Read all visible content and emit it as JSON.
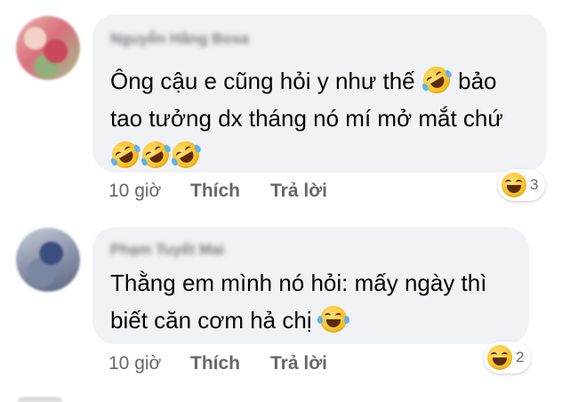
{
  "comments": [
    {
      "author": "Nguyễn Hằng Bosa",
      "text_lines": [
        "Ông cậu e cũng hỏi y như thế",
        "bảo",
        "tao tưởng dx tháng nó mí mở mắt chứ"
      ],
      "time": "10 giờ",
      "like_label": "Thích",
      "reply_label": "Trả lời",
      "reaction_icon": "laughing-face-icon",
      "reaction_count": "3"
    },
    {
      "author": "Phạm Tuyết Mai",
      "text_lines": [
        "Thằng em mình nó hỏi: mấy ngày thì",
        "biết căn cơm hả chị"
      ],
      "time": "10 giờ",
      "like_label": "Thích",
      "reply_label": "Trả lời",
      "reaction_icon": "laughing-face-icon",
      "reaction_count": "2"
    }
  ]
}
